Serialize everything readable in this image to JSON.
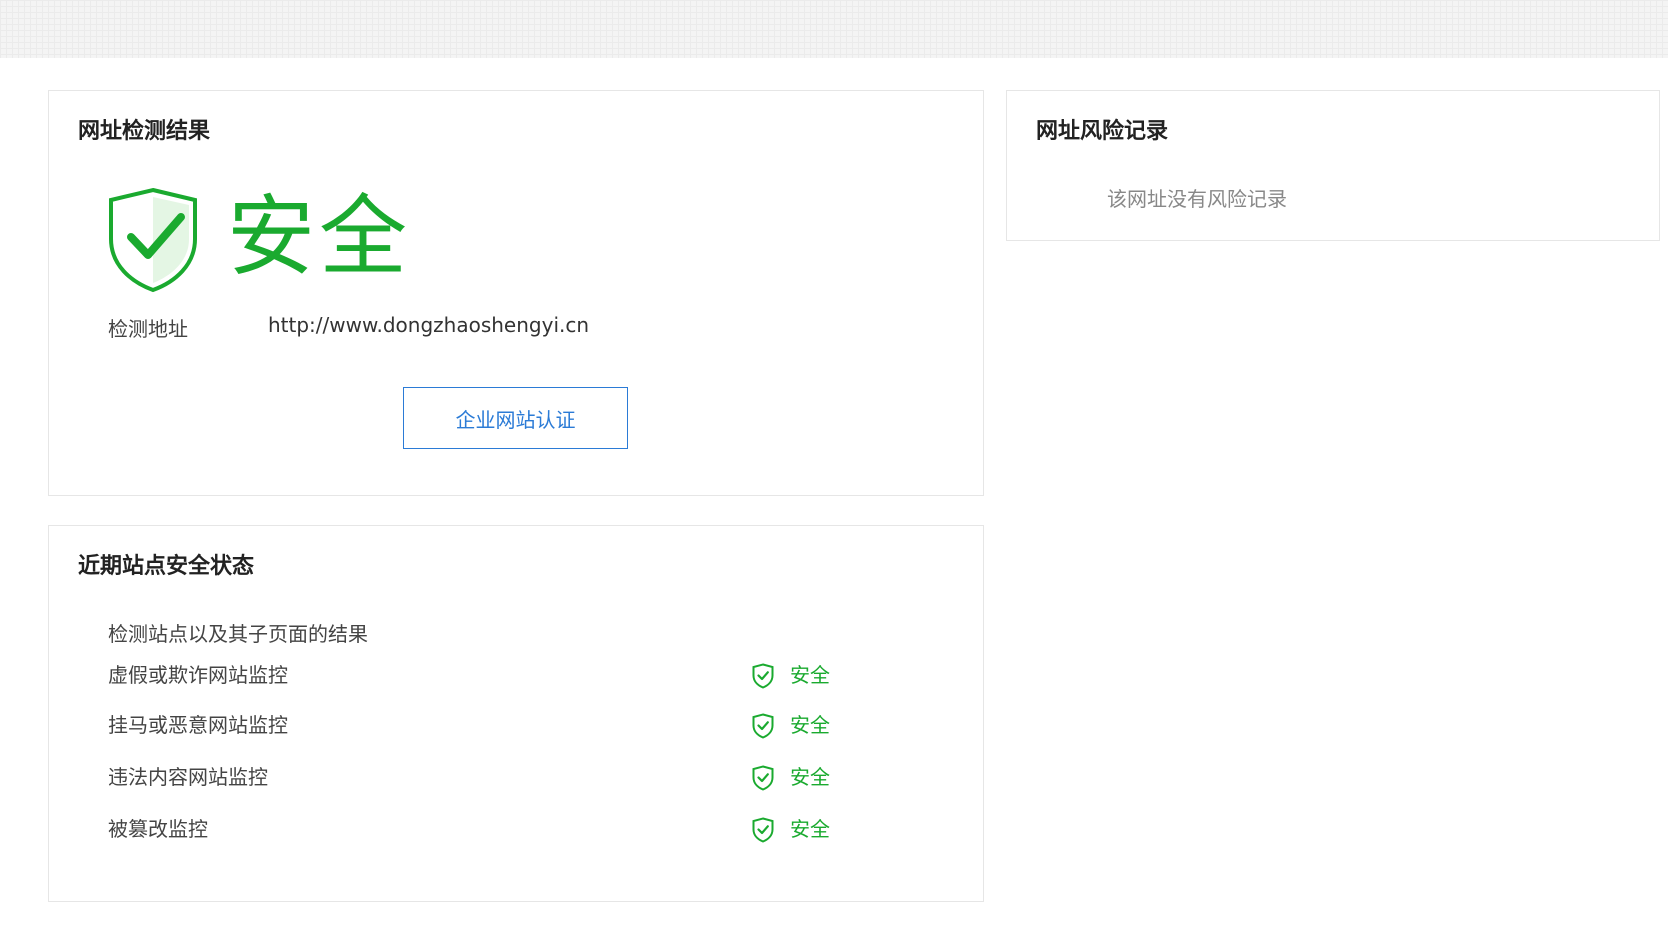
{
  "result_card": {
    "title": "网址检测结果",
    "status_text": "安全",
    "url_label": "检测地址",
    "url_value": "http://www.dongzhaoshengyi.cn",
    "cert_button_label": "企业网站认证"
  },
  "status_card": {
    "title": "近期站点安全状态",
    "subtitle": "检测站点以及其子页面的结果",
    "rows": [
      {
        "label": "虚假或欺诈网站监控",
        "status": "安全"
      },
      {
        "label": "挂马或恶意网站监控",
        "status": "安全"
      },
      {
        "label": "违法内容网站监控",
        "status": "安全"
      },
      {
        "label": "被篡改监控",
        "status": "安全"
      }
    ]
  },
  "risk_card": {
    "title": "网址风险记录",
    "empty_text": "该网址没有风险记录"
  },
  "icons": {
    "big_status_icon": "shield-check-icon",
    "row_status_icon": "shield-check-icon"
  },
  "colors": {
    "safe_green": "#1aaa2f",
    "link_blue": "#2b7bd6",
    "border": "#e6e6e6"
  }
}
